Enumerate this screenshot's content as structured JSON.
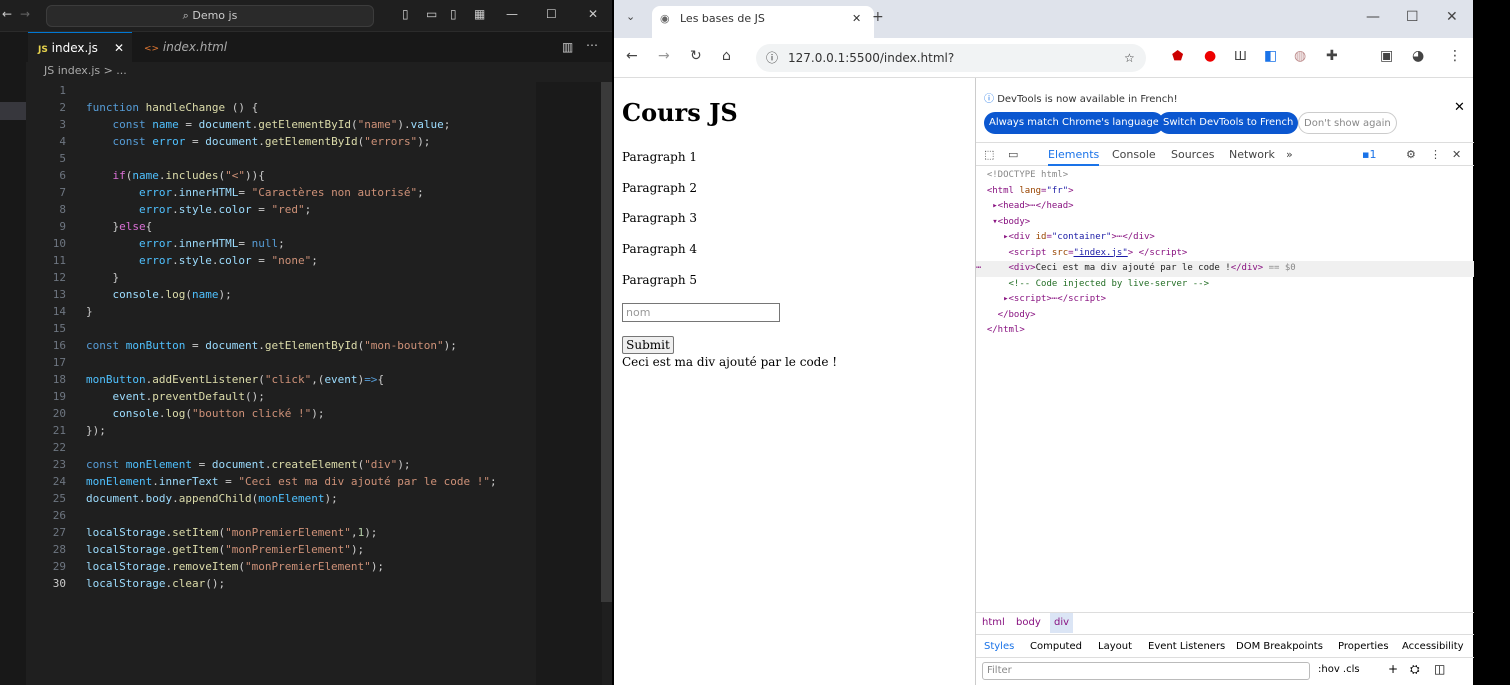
{
  "vscode": {
    "search": "Demo js",
    "tabs": [
      {
        "label": "index.js",
        "icon": "JS"
      },
      {
        "label": "index.html",
        "icon": "<>"
      }
    ],
    "breadcrumb": "JS index.js > ...",
    "line_numbers": [
      "1",
      "2",
      "3",
      "4",
      "5",
      "6",
      "7",
      "8",
      "9",
      "10",
      "11",
      "12",
      "13",
      "14",
      "15",
      "16",
      "17",
      "18",
      "19",
      "20",
      "21",
      "22",
      "23",
      "24",
      "25",
      "26",
      "27",
      "28",
      "29",
      "30"
    ]
  },
  "chrome": {
    "tab_title": "Les bases de JS",
    "url": "127.0.0.1:5500/index.html?",
    "page": {
      "heading": "Cours JS",
      "paragraphs": [
        "Paragraph 1",
        "Paragraph 2",
        "Paragraph 3",
        "Paragraph 4",
        "Paragraph 5"
      ],
      "input_placeholder": "nom",
      "submit": "Submit",
      "added_text": "Ceci est ma div ajouté par le code !"
    },
    "devtools": {
      "notice": "DevTools is now available in French!",
      "btn_match": "Always match Chrome's language",
      "btn_switch": "Switch DevTools to French",
      "btn_dont": "Don't show again",
      "tabs": [
        "Elements",
        "Console",
        "Sources",
        "Network"
      ],
      "issues_count": "1",
      "crumbs": [
        "html",
        "body",
        "div"
      ],
      "styles_tabs": [
        "Styles",
        "Computed",
        "Layout",
        "Event Listeners",
        "DOM Breakpoints",
        "Properties",
        "Accessibility"
      ],
      "filter_placeholder": "Filter",
      "filter_tools": ":hov .cls"
    }
  }
}
